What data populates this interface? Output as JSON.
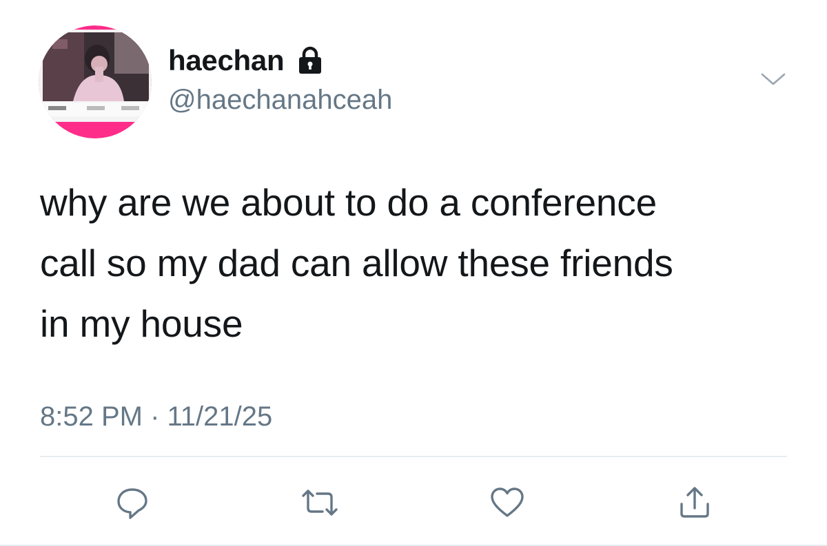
{
  "author": {
    "display_name": "haechan",
    "handle": "@haechanahceah",
    "protected": true
  },
  "tweet": {
    "text": "why are we about to do a conference\ncall so my dad can allow these friends\nin my house",
    "timestamp": "8:52 PM · 11/21/25"
  },
  "icons": {
    "lock": "lock-icon",
    "caret": "chevron-down-icon",
    "reply": "reply-icon",
    "retweet": "retweet-icon",
    "like": "heart-icon",
    "share": "share-icon"
  },
  "colors": {
    "text_primary": "#14171a",
    "text_secondary": "#657786",
    "icon_gray": "#657786",
    "divider": "#e6ecf0",
    "avatar_ring": "#ff2d8a"
  }
}
